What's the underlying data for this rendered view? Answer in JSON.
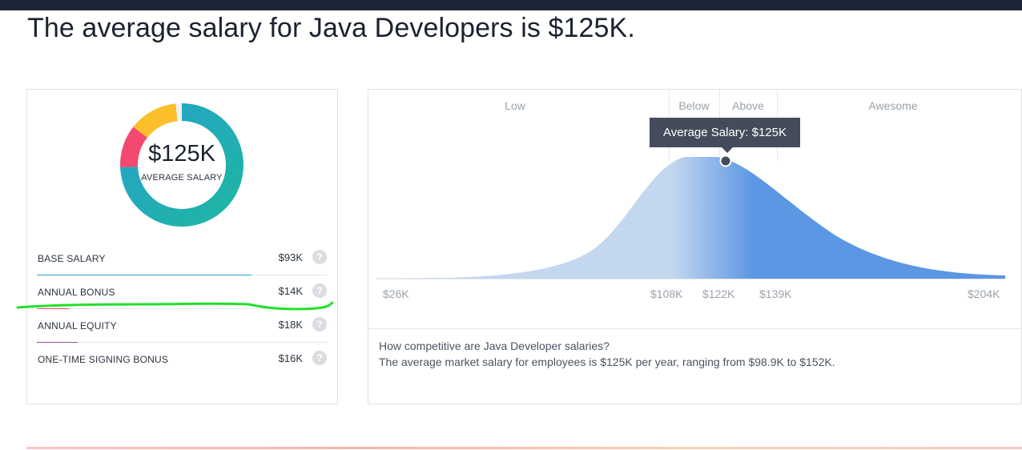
{
  "headline": "The average salary for Java Developers is $125K.",
  "colors": {
    "top_bar": "#1b2536",
    "donut_base": "#25a3c9",
    "donut_base_end": "#1fb5a3",
    "donut_bonus": "#f3486f",
    "donut_equity": "#f3486f",
    "donut_signing": "#fbbf2b",
    "curve_light": "#c3d7ef",
    "curve_dark": "#5b97e2",
    "annotation_stroke": "#22e02a"
  },
  "summary": {
    "amount": "$125K",
    "label": "AVERAGE SALARY",
    "donut_share": {
      "base": 0.744,
      "bonus": 0.112,
      "signing": 0.128
    }
  },
  "components": [
    {
      "label": "BASE SALARY",
      "value": "$93K",
      "help_icon": "question-icon",
      "bar_color": "#25a3c9",
      "bar_fraction": 0.74
    },
    {
      "label": "ANNUAL BONUS",
      "value": "$14K",
      "help_icon": "question-icon",
      "bar_color": "#f3486f",
      "bar_fraction": 0.11
    },
    {
      "label": "ANNUAL EQUITY",
      "value": "$18K",
      "help_icon": "question-icon",
      "bar_color": "#9a4ea0",
      "bar_fraction": 0.14
    },
    {
      "label": "ONE-TIME SIGNING BONUS",
      "value": "$16K",
      "help_icon": "question-icon",
      "bar_color": "#fbbf2b",
      "bar_fraction": 0.0
    }
  ],
  "distribution": {
    "segments": [
      "Low",
      "Below",
      "Above",
      "Awesome"
    ],
    "tooltip": "Average Salary: $125K",
    "ticks": [
      "$26K",
      "$108K",
      "$122K",
      "$139K",
      "$204K"
    ],
    "question": "How competitive are Java Developer salaries?",
    "answer": "The average market salary for employees is $125K per year, ranging from $98.9K to $152K."
  }
}
